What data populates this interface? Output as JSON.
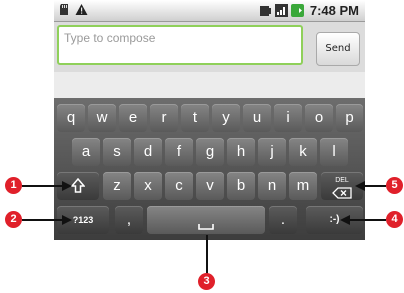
{
  "status_bar": {
    "time": "7:48 PM",
    "left_icons": [
      "sd-card-icon",
      "warning-icon"
    ],
    "right_icons": [
      "sim-icon",
      "signal-icon",
      "battery-icon"
    ]
  },
  "compose": {
    "placeholder": "Type to compose",
    "send_label": "Send"
  },
  "keyboard": {
    "row1": [
      "q",
      "w",
      "e",
      "r",
      "t",
      "y",
      "u",
      "i",
      "o",
      "p"
    ],
    "row2": [
      "a",
      "s",
      "d",
      "f",
      "g",
      "h",
      "j",
      "k",
      "l"
    ],
    "row3": [
      "z",
      "x",
      "c",
      "v",
      "b",
      "n",
      "m"
    ],
    "shift_icon": "shift-icon",
    "del_label": "DEL",
    "symbols_label": "?123",
    "comma": ",",
    "period": ".",
    "smiley": ":-)"
  },
  "callouts": [
    "1",
    "2",
    "3",
    "4",
    "5"
  ],
  "colors": {
    "callout_badge": "#e0202a",
    "input_border": "#8fd05a"
  }
}
